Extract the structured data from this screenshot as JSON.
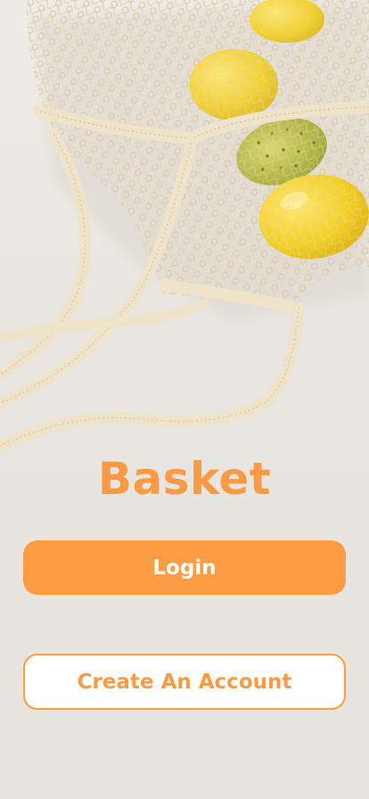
{
  "app": {
    "name": "Basket"
  },
  "actions": {
    "login_label": "Login",
    "create_account_label": "Create An Account"
  },
  "colors": {
    "accent": "#fd9c43",
    "background": "#eae7e2",
    "button_text_light": "#ffffff"
  },
  "hero": {
    "icon": "mesh-bag-with-lemons-photo"
  }
}
